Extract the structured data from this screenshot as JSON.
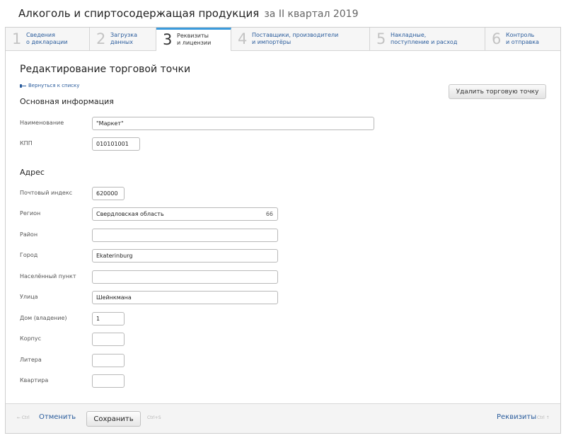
{
  "header": {
    "title": "Алкоголь и спиртосодержащая продукция",
    "subtitle": "за II квартал 2019"
  },
  "steps": [
    {
      "num": "1",
      "line1": "Сведения",
      "line2": "о декларации"
    },
    {
      "num": "2",
      "line1": "Загрузка",
      "line2": "данных"
    },
    {
      "num": "3",
      "line1": "Реквизиты",
      "line2": "и лицензии",
      "active": true
    },
    {
      "num": "4",
      "line1": "Поставщики, производители",
      "line2": "и импортёры"
    },
    {
      "num": "5",
      "line1": "Накладные,",
      "line2": "поступление и расход"
    },
    {
      "num": "6",
      "line1": "Контроль",
      "line2": "и отправка"
    }
  ],
  "page": {
    "title": "Редактирование торговой точки",
    "back_label": "Вернуться к списку",
    "delete_label": "Удалить торговую точку"
  },
  "basic": {
    "heading": "Основная информация",
    "name_label": "Наименование",
    "name_value": "\"Маркет\"",
    "kpp_label": "КПП",
    "kpp_value": "010101001"
  },
  "address": {
    "heading": "Адрес",
    "postcode_label": "Почтовый индекс",
    "postcode_value": "620000",
    "region_label": "Регион",
    "region_value": "Свердловская область",
    "region_code": "66",
    "district_label": "Район",
    "district_value": "",
    "city_label": "Город",
    "city_value": "Ekaterinburg",
    "settlement_label": "Населённый пункт",
    "settlement_value": "",
    "street_label": "Улица",
    "street_value": "Шейнкмана",
    "house_label": "Дом (владение)",
    "house_value": "1",
    "building_label": "Корпус",
    "building_value": "",
    "letter_label": "Литера",
    "letter_value": "",
    "apartment_label": "Квартира",
    "apartment_value": ""
  },
  "footer": {
    "back_hint": "← Ctrl",
    "cancel_label": "Отменить",
    "save_label": "Сохранить",
    "save_hint": "Ctrl+S",
    "next_label": "Реквизиты",
    "next_hint": "Ctrl ↑"
  }
}
